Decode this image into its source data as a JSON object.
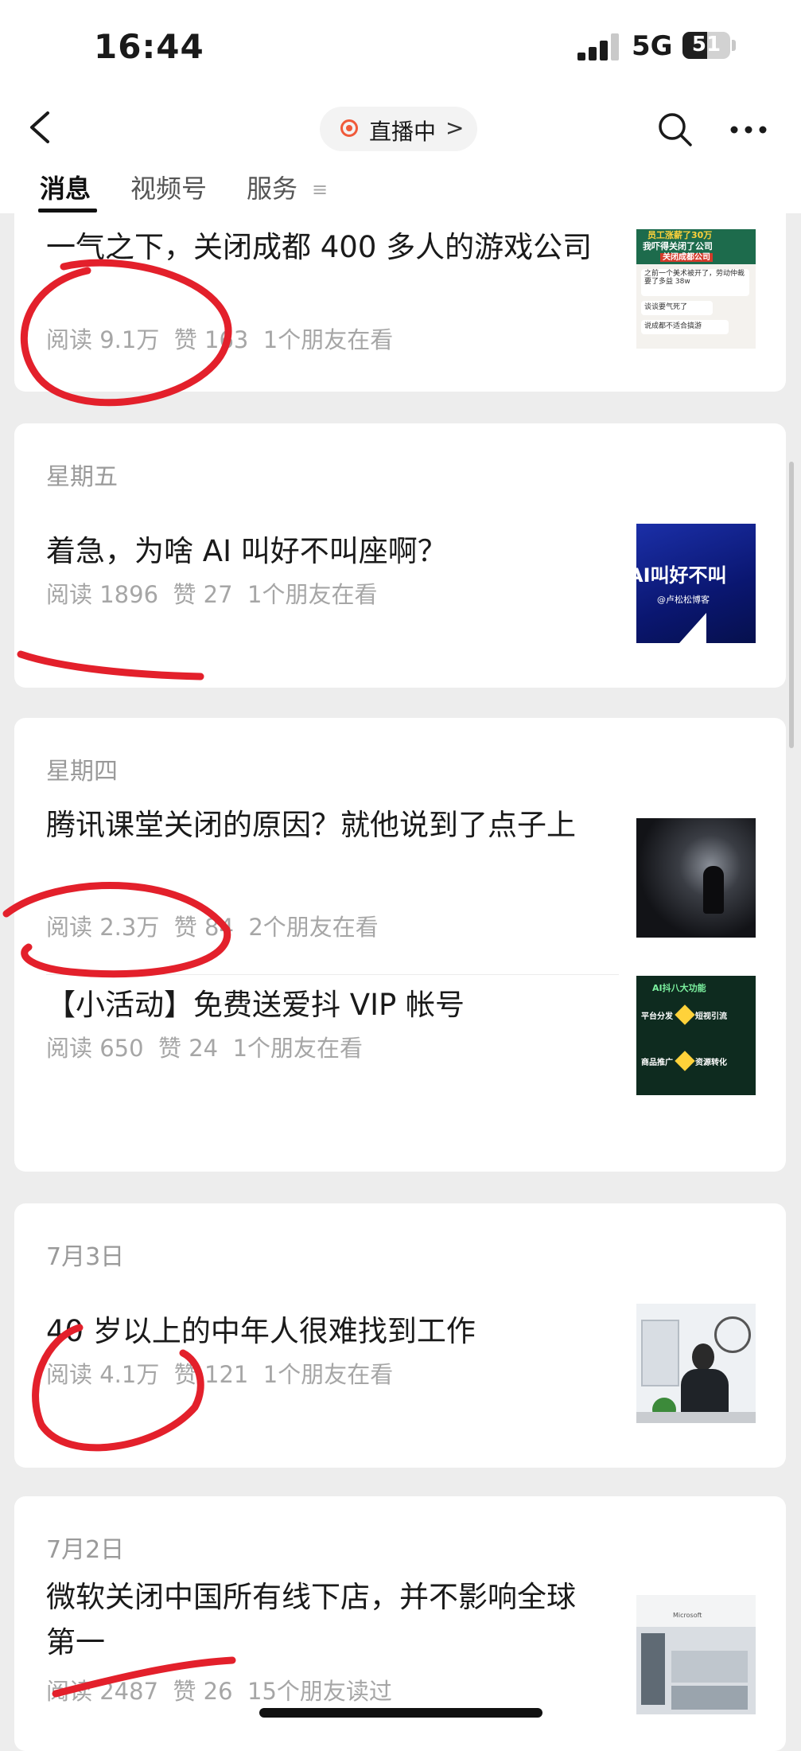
{
  "status_bar": {
    "time": "16:44",
    "network": "5G",
    "battery": "51",
    "battery_level": 0.51
  },
  "header": {
    "live_label": "直播中",
    "live_chevron": ">"
  },
  "tabs": [
    {
      "label": "消息",
      "active": true
    },
    {
      "label": "视频号",
      "active": false
    },
    {
      "label": "服务",
      "active": false
    }
  ],
  "tab_menu_icon": "≡",
  "icons": [
    "back-chevron-icon",
    "live-dot-icon",
    "search-icon",
    "more-icon",
    "signal-icon",
    "battery-icon"
  ],
  "colors": {
    "accent_live": "#f05a3a",
    "annotation_red": "#e3202b",
    "background": "#ededed",
    "card": "#ffffff",
    "muted_text": "#a6a6a6"
  },
  "feed": [
    {
      "date": "",
      "articles": [
        {
          "title": "一气之下，关闭成都 400 多人的游戏公司",
          "stats": "阅读 9.1万  赞 163  1个朋友在看",
          "thumb": {
            "lines": [
              "员工涨薪了30万",
              "我吓得关闭了公司",
              "关闭成都公司",
              "之前一个美术被开了，劳动仲裁要了多益 38w",
              "谈谈要气死了",
              "说成都不适合搞游"
            ]
          }
        }
      ]
    },
    {
      "date": "星期五",
      "articles": [
        {
          "title": "着急，为啥 AI 叫好不叫座啊？",
          "stats": "阅读 1896  赞 27  1个朋友在看",
          "thumb": {
            "lines": [
              "AI叫好不叫",
              "@卢松松博客"
            ]
          }
        }
      ]
    },
    {
      "date": "星期四",
      "articles": [
        {
          "title": "腾讯课堂关闭的原因？就他说到了点子上",
          "stats": "阅读 2.3万  赞 84  2个朋友在看",
          "thumb": {
            "lines": []
          }
        },
        {
          "title": "【小活动】免费送爱抖 VIP 帐号",
          "stats": "阅读 650  赞 24  1个朋友在看",
          "thumb": {
            "lines": [
              "AI抖八大功能",
              "平台分发",
              "短视引流",
              "商品推广",
              "资源转化"
            ]
          }
        }
      ]
    },
    {
      "date": "7月3日",
      "articles": [
        {
          "title": "40 岁以上的中年人很难找到工作",
          "stats": "阅读 4.1万  赞 121  1个朋友在看",
          "thumb": {
            "lines": []
          }
        }
      ]
    },
    {
      "date": "7月2日",
      "articles": [
        {
          "title": "微软关闭中国所有线下店，并不影响全球第一",
          "stats": "阅读 2487  赞 26  15个朋友读过",
          "thumb": {
            "lines": [
              "Microsoft"
            ]
          }
        }
      ]
    }
  ]
}
